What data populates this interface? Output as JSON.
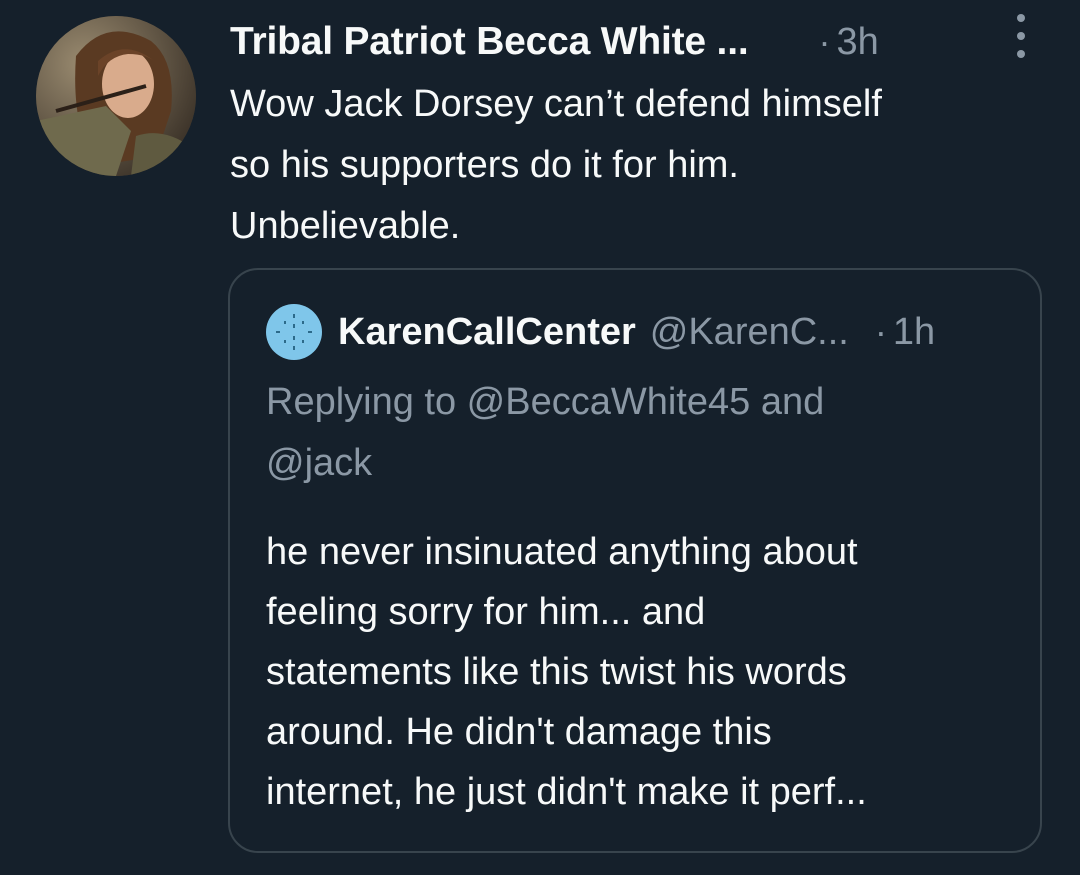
{
  "tweet": {
    "author_name": "Tribal Patriot Becca White ...",
    "time_dot": "·",
    "time": "3h",
    "more_icon": "more-vertical-icon",
    "text_lines": [
      "Wow Jack Dorsey can’t defend himself",
      "so his supporters do it for him.",
      "Unbelievable."
    ]
  },
  "quoted_tweet": {
    "author_name": "KarenCallCenter",
    "handle": "@KarenC...",
    "time_dot": "·",
    "time": "1h",
    "reply_context_lines": [
      "Replying to @BeccaWhite45 and",
      "@jack"
    ],
    "text_lines": [
      "he never insinuated anything about",
      "feeling sorry for him... and",
      "statements like this twist his words",
      "around. He didn't damage this",
      "internet, he just didn't make it perf..."
    ]
  },
  "colors": {
    "background": "#15202b",
    "primary_text": "#f7f9f9",
    "secondary_text": "#8b98a5",
    "border": "#38444d",
    "quote_avatar": "#7fc6ea"
  }
}
